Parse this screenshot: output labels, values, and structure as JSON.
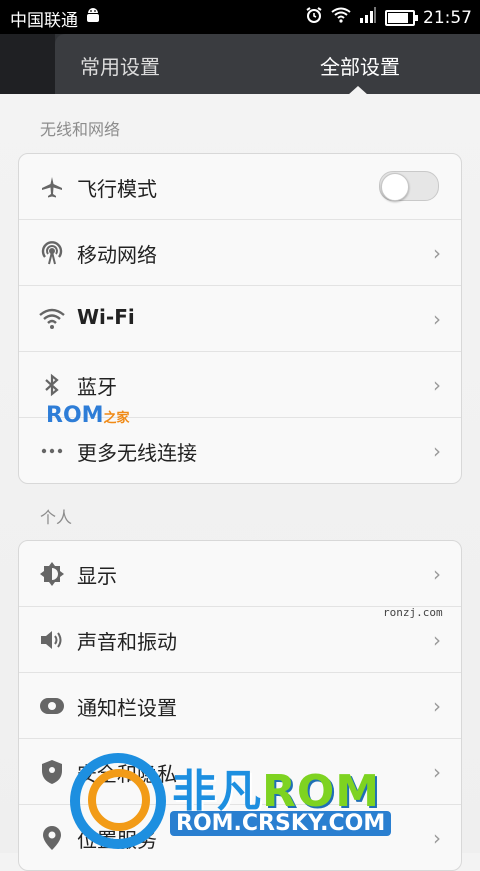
{
  "status_bar": {
    "carrier": "中国联通",
    "time": "21:57"
  },
  "tabs": [
    {
      "label": "常用设置",
      "active": false
    },
    {
      "label": "全部设置",
      "active": true
    }
  ],
  "sections": [
    {
      "title": "无线和网络",
      "items": [
        {
          "icon": "airplane-icon",
          "label": "飞行模式",
          "control": "toggle",
          "toggle_on": false
        },
        {
          "icon": "mobile-network-icon",
          "label": "移动网络",
          "control": "chevron"
        },
        {
          "icon": "wifi-icon",
          "label": "Wi-Fi",
          "control": "chevron"
        },
        {
          "icon": "bluetooth-icon",
          "label": "蓝牙",
          "control": "chevron"
        },
        {
          "icon": "more-icon",
          "label": "更多无线连接",
          "control": "chevron"
        }
      ]
    },
    {
      "title": "个人",
      "items": [
        {
          "icon": "brightness-icon",
          "label": "显示",
          "control": "chevron"
        },
        {
          "icon": "sound-icon",
          "label": "声音和振动",
          "control": "chevron"
        },
        {
          "icon": "notification-icon",
          "label": "通知栏设置",
          "control": "chevron"
        },
        {
          "icon": "security-icon",
          "label": "安全和隐私",
          "control": "chevron"
        },
        {
          "icon": "location-icon",
          "label": "位置服务",
          "control": "chevron"
        }
      ]
    }
  ],
  "watermarks": {
    "rom_zhijia_prefix": "ROM",
    "rom_zhijia_suffix": "之家",
    "ronzj": "ronzj.com",
    "feifan_cn": "非凡",
    "feifan_rom": "ROM",
    "crsky_url": "ROM.CRSKY.COM"
  },
  "colors": {
    "tab_bar": "#3a3c40",
    "status_bar": "#000000",
    "card_bg": "#f9f9f9"
  }
}
